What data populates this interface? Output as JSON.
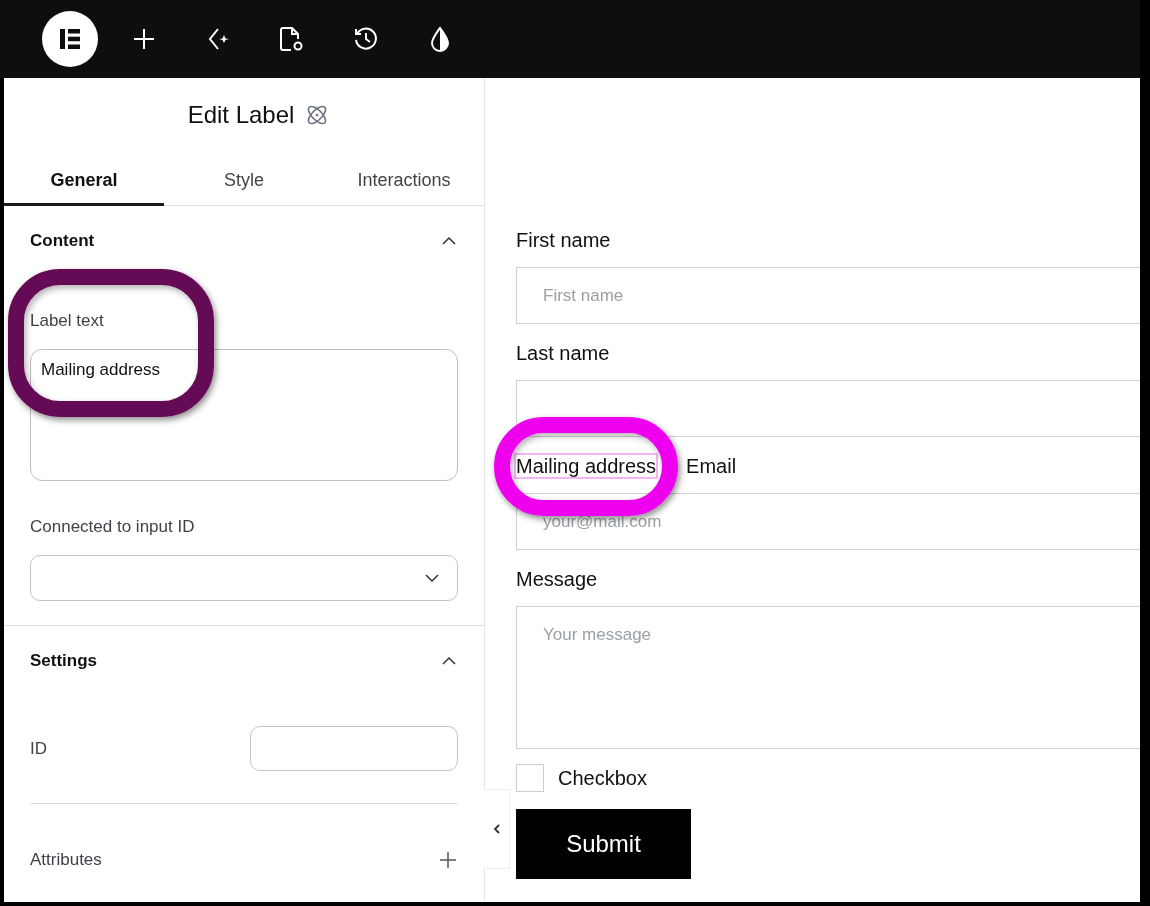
{
  "panel": {
    "title": "Edit Label",
    "tabs": [
      {
        "label": "General",
        "selected": true
      },
      {
        "label": "Style",
        "selected": false
      },
      {
        "label": "Interactions",
        "selected": false
      }
    ],
    "content": {
      "highlight": {
        "color": "#650a55"
      },
      "heading": "Content",
      "expanded": true,
      "label_text_caption": "Label text",
      "label_text_value": "Mailing address",
      "input_id_caption": "Connected to input ID"
    },
    "settings": {
      "heading": "Settings",
      "expanded": true,
      "id_caption": "ID",
      "attributes_caption": "Attributes"
    }
  },
  "form": {
    "fields": [
      {
        "kind": "input",
        "label": "First name",
        "placeholder": "First name"
      },
      {
        "kind": "input",
        "label": "Last name"
      },
      {
        "kind": "input",
        "extra_label": "Mailing address",
        "highlight": {
          "color": "#ee00ee"
        },
        "label": "Email",
        "placeholder": "your@mail.com"
      },
      {
        "kind": "textarea",
        "label": "Message",
        "placeholder": "Your message"
      }
    ],
    "checkbox": {
      "label": "Checkbox",
      "checked": false
    },
    "submit": "Submit"
  }
}
